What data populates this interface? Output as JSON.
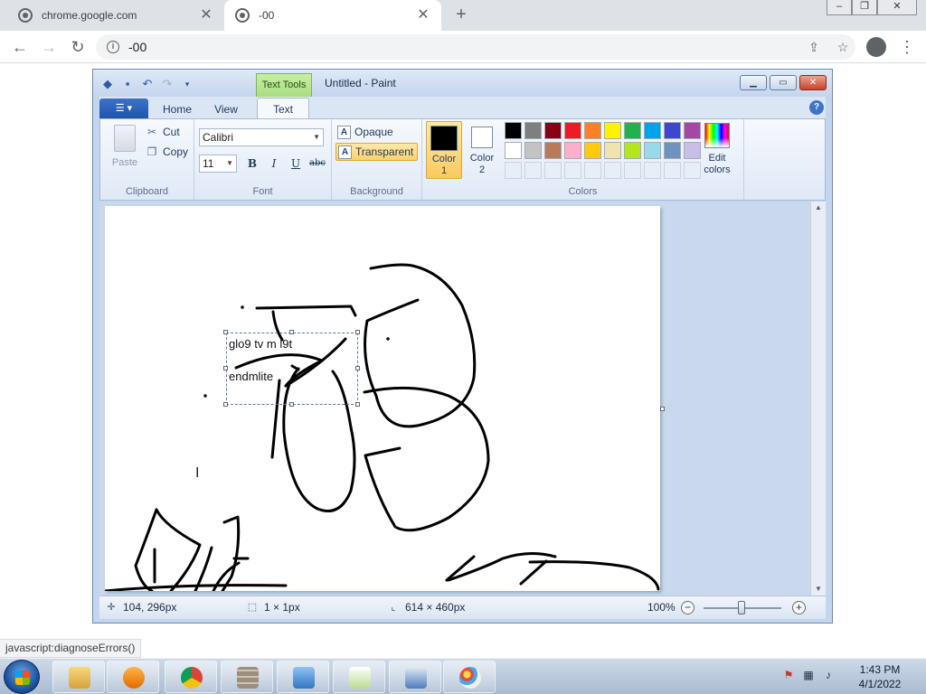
{
  "browser": {
    "tabs": [
      {
        "title": "chrome.google.com",
        "active": false
      },
      {
        "title": "-00",
        "active": true
      }
    ],
    "address": "-00",
    "status_url": "javascript:diagnoseErrors()"
  },
  "paint": {
    "context_tab": "Text Tools",
    "title": "Untitled - Paint",
    "tabs": [
      "Home",
      "View",
      "Text"
    ],
    "active_tab": "Text",
    "clipboard": {
      "paste": "Paste",
      "cut": "Cut",
      "copy": "Copy",
      "label": "Clipboard"
    },
    "font": {
      "family": "Calibri",
      "size": "11",
      "bold": "B",
      "italic": "I",
      "underline": "U",
      "strike": "abc",
      "label": "Font"
    },
    "background": {
      "opaque": "Opaque",
      "transparent": "Transparent",
      "selected": "Transparent",
      "label": "Background"
    },
    "colors": {
      "color1_line1": "Color",
      "color1_line2": "1",
      "color1_value": "#000000",
      "color2_line1": "Color",
      "color2_line2": "2",
      "color2_value": "#ffffff",
      "palette_row1": [
        "#000000",
        "#7f7f7f",
        "#880015",
        "#ed1c24",
        "#ff7f27",
        "#fff200",
        "#22b14c",
        "#00a2e8",
        "#3f48cc",
        "#a349a4"
      ],
      "palette_row2": [
        "#ffffff",
        "#c3c3c3",
        "#b97a57",
        "#ffaec9",
        "#ffc90e",
        "#efe4b0",
        "#b5e61d",
        "#99d9ea",
        "#7092be",
        "#c8bfe7"
      ],
      "edit_line1": "Edit",
      "edit_line2": "colors",
      "label": "Colors"
    },
    "canvas": {
      "textbox_lines": [
        "glo9 tv m l9t",
        "endmlite"
      ]
    },
    "status": {
      "cursor": "104, 296px",
      "selection": "1 × 1px",
      "canvas_size": "614 × 460px",
      "zoom": "100%"
    }
  },
  "taskbar": {
    "time": "1:43 PM",
    "date": "4/1/2022"
  }
}
